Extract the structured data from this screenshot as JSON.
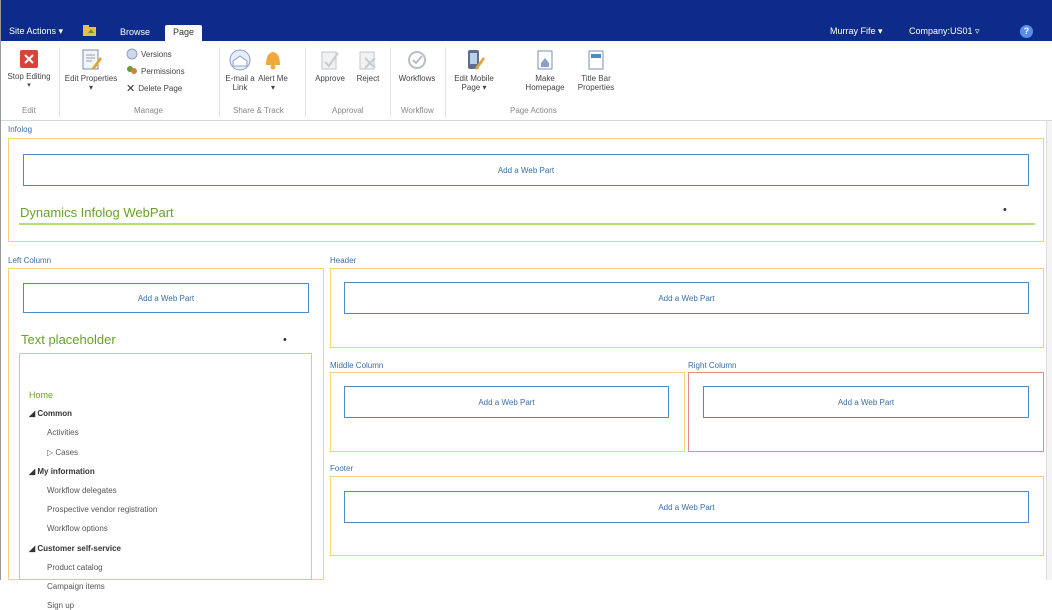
{
  "topbar": {
    "site_actions": "Site Actions ▾",
    "tabs": [
      "Browse",
      "Page"
    ],
    "user": "Murray Fife ▾",
    "company": "Company:US01 ▿",
    "help": "?"
  },
  "ribbon": {
    "stop_editing": "Stop Editing",
    "edit_properties": "Edit Properties ▾",
    "versions": "Versions",
    "permissions": "Permissions",
    "delete_page": "Delete Page",
    "email_link": "E-mail a Link",
    "alert_me": "Alert Me ▾",
    "approve": "Approve",
    "reject": "Reject",
    "workflows": "Workflows",
    "edit_mobile": "Edit Mobile Page ▾",
    "make_homepage": "Make Homepage",
    "title_bar": "Title Bar Properties",
    "groups": [
      "Edit",
      "Manage",
      "Share & Track",
      "Approval",
      "Workflow",
      "Page Actions"
    ]
  },
  "zones": {
    "infolog": "Infolog",
    "left_column": "Left Column",
    "header": "Header",
    "middle_column": "Middle Column",
    "right_column": "Right Column",
    "footer": "Footer"
  },
  "add_web_part": "Add a Web Part",
  "webparts": {
    "infolog_title": "Dynamics Infolog WebPart",
    "text_placeholder": "Text placeholder"
  },
  "nav": [
    {
      "label": "Home",
      "kind": "home"
    },
    {
      "label": "◢ Common",
      "kind": "section"
    },
    {
      "label": "Activities",
      "kind": "item"
    },
    {
      "label": "▷ Cases",
      "kind": "item"
    },
    {
      "label": "◢ My information",
      "kind": "section"
    },
    {
      "label": "Workflow delegates",
      "kind": "item"
    },
    {
      "label": "Prospective vendor registration",
      "kind": "item"
    },
    {
      "label": "Workflow options",
      "kind": "item"
    },
    {
      "label": "◢ Customer self-service",
      "kind": "section"
    },
    {
      "label": "Product catalog",
      "kind": "item"
    },
    {
      "label": "Campaign items",
      "kind": "item"
    },
    {
      "label": "Sign up",
      "kind": "item"
    }
  ],
  "dot": "•"
}
